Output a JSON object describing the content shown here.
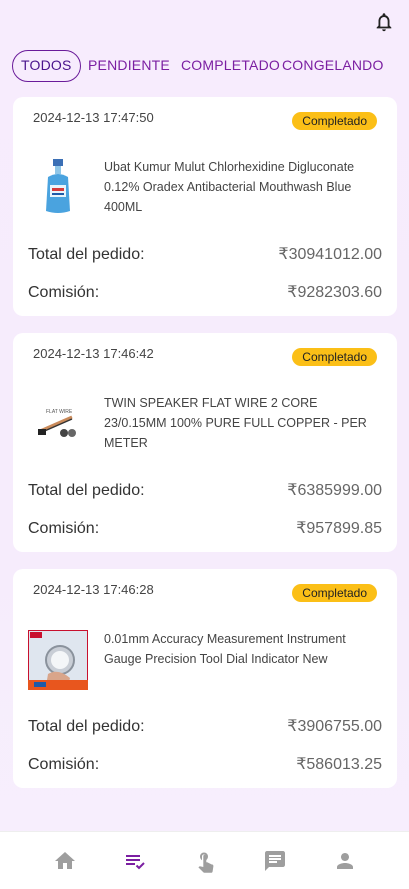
{
  "header": {
    "notification_icon": "bell-icon"
  },
  "tabs": [
    {
      "label": "TODOS",
      "active": true
    },
    {
      "label": "PENDIENTE",
      "active": false
    },
    {
      "label": "COMPLETADO",
      "active": false
    },
    {
      "label": "CONGELANDO",
      "active": false
    }
  ],
  "orders": [
    {
      "time": "2024-12-13 17:47:50",
      "status": "Completado",
      "title": "Ubat Kumur Mulut Chlorhexidine Digluconate 0.12% Oradex Antibacterial Mouthwash Blue 400ML",
      "total_label": "Total del pedido:",
      "total_value": "₹30941012.00",
      "commission_label": "Comisión:",
      "commission_value": "₹9282303.60"
    },
    {
      "time": "2024-12-13 17:46:42",
      "status": "Completado",
      "title": "TWIN SPEAKER FLAT WIRE 2 CORE 23/0.15MM 100% PURE FULL COPPER - PER METER",
      "total_label": "Total del pedido:",
      "total_value": "₹6385999.00",
      "commission_label": "Comisión:",
      "commission_value": "₹957899.85"
    },
    {
      "time": "2024-12-13 17:46:28",
      "status": "Completado",
      "title": "0.01mm Accuracy Measurement Instrument Gauge Precision Tool Dial Indicator New",
      "total_label": "Total del pedido:",
      "total_value": "₹3906755.00",
      "commission_label": "Comisión:",
      "commission_value": "₹586013.25"
    }
  ],
  "bottom_nav": [
    {
      "icon": "home-icon",
      "active": false
    },
    {
      "icon": "orders-list-icon",
      "active": true
    },
    {
      "icon": "tap-hand-icon",
      "active": false
    },
    {
      "icon": "chat-icon",
      "active": false
    },
    {
      "icon": "person-icon",
      "active": false
    }
  ],
  "colors": {
    "accent": "#7b1fa2",
    "badge": "#fbbf17",
    "background": "#f7ecfd"
  }
}
